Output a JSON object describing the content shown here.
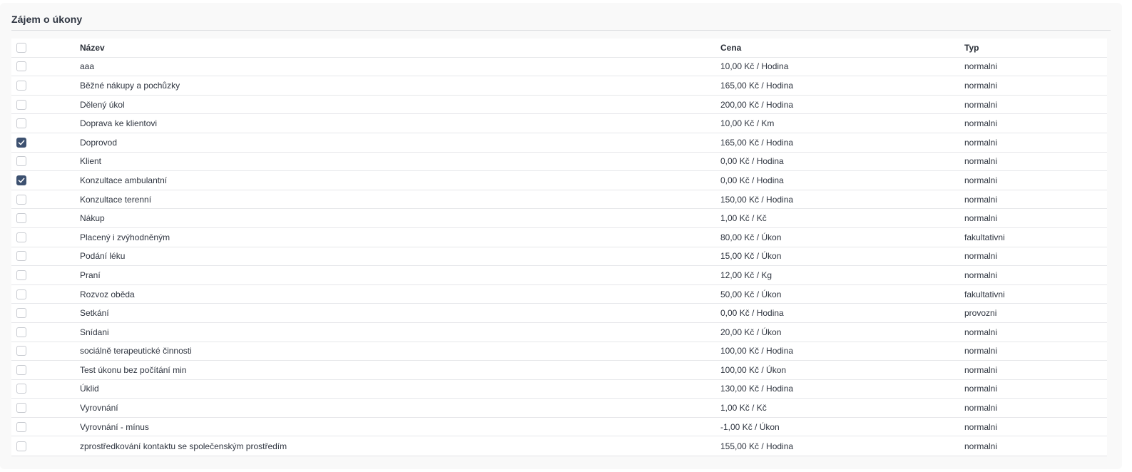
{
  "panel": {
    "title": "Zájem o úkony"
  },
  "table": {
    "headers": {
      "name": "Název",
      "price": "Cena",
      "type": "Typ"
    },
    "header_checked": false,
    "rows": [
      {
        "checked": false,
        "name": "aaa",
        "price": "10,00 Kč / Hodina",
        "type": "normalni"
      },
      {
        "checked": false,
        "name": "Běžné nákupy a pochůzky",
        "price": "165,00 Kč / Hodina",
        "type": "normalni"
      },
      {
        "checked": false,
        "name": "Dělený úkol",
        "price": "200,00 Kč / Hodina",
        "type": "normalni"
      },
      {
        "checked": false,
        "name": "Doprava ke klientovi",
        "price": "10,00 Kč / Km",
        "type": "normalni"
      },
      {
        "checked": true,
        "name": "Doprovod",
        "price": "165,00 Kč / Hodina",
        "type": "normalni"
      },
      {
        "checked": false,
        "name": "Klient",
        "price": "0,00 Kč / Hodina",
        "type": "normalni"
      },
      {
        "checked": true,
        "name": "Konzultace ambulantní",
        "price": "0,00 Kč / Hodina",
        "type": "normalni"
      },
      {
        "checked": false,
        "name": "Konzultace terenní",
        "price": "150,00 Kč / Hodina",
        "type": "normalni"
      },
      {
        "checked": false,
        "name": "Nákup",
        "price": "1,00 Kč / Kč",
        "type": "normalni"
      },
      {
        "checked": false,
        "name": "Placený i zvýhodněným",
        "price": "80,00 Kč / Úkon",
        "type": "fakultativni"
      },
      {
        "checked": false,
        "name": "Podání léku",
        "price": "15,00 Kč / Úkon",
        "type": "normalni"
      },
      {
        "checked": false,
        "name": "Praní",
        "price": "12,00 Kč / Kg",
        "type": "normalni"
      },
      {
        "checked": false,
        "name": "Rozvoz oběda",
        "price": "50,00 Kč / Úkon",
        "type": "fakultativni"
      },
      {
        "checked": false,
        "name": "Setkání",
        "price": "0,00 Kč / Hodina",
        "type": "provozni"
      },
      {
        "checked": false,
        "name": "Snídani",
        "price": "20,00 Kč / Úkon",
        "type": "normalni"
      },
      {
        "checked": false,
        "name": "sociálně terapeutické činnosti",
        "price": "100,00 Kč / Hodina",
        "type": "normalni"
      },
      {
        "checked": false,
        "name": "Test úkonu bez počítání min",
        "price": "100,00 Kč / Úkon",
        "type": "normalni"
      },
      {
        "checked": false,
        "name": "Úklid",
        "price": "130,00 Kč / Hodina",
        "type": "normalni"
      },
      {
        "checked": false,
        "name": "Vyrovnání",
        "price": "1,00 Kč / Kč",
        "type": "normalni"
      },
      {
        "checked": false,
        "name": "Vyrovnání - mínus",
        "price": "-1,00 Kč / Úkon",
        "type": "normalni"
      },
      {
        "checked": false,
        "name": "zprostředkování kontaktu se společenským prostředím",
        "price": "155,00 Kč / Hodina",
        "type": "normalni"
      }
    ]
  },
  "colors": {
    "checkbox_checked": "#3d5170",
    "panel_background": "#f9f9f9"
  },
  "icons": {
    "checkmark": "check-icon"
  }
}
